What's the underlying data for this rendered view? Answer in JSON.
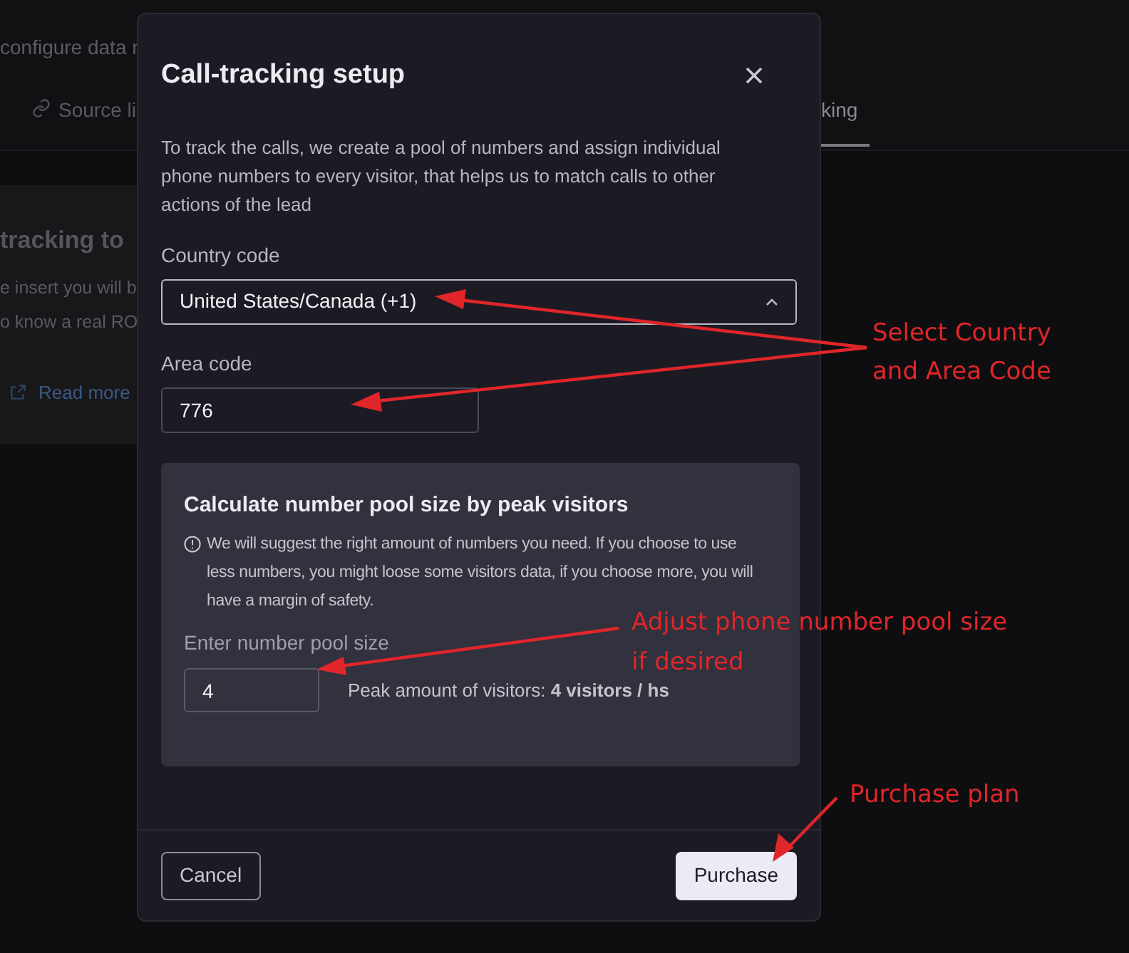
{
  "background": {
    "intro_text": "configure data r",
    "tabs": [
      {
        "label": "Source li",
        "selected": false
      },
      {
        "label": "king",
        "selected": true
      }
    ],
    "card": {
      "title": "tracking to",
      "lines": [
        "e insert you will b",
        "o know a real RO"
      ],
      "link": "Read more"
    }
  },
  "dialog": {
    "title": "Call-tracking setup",
    "description": "To track the calls, we create a pool of numbers and assign individual phone numbers to every visitor, that helps us to match calls to other actions of the lead",
    "country_code": {
      "label": "Country code",
      "value": "United States/Canada (+1)",
      "expanded": true
    },
    "area_code": {
      "label": "Area code",
      "value": "776"
    },
    "pool_panel": {
      "title": "Calculate number pool size by peak visitors",
      "info": "We will suggest the right amount of numbers you need. If you choose to use less numbers, you might loose some visitors data, if you choose more, you will have a margin of safety.",
      "input_label": "Enter number pool size",
      "value": "4",
      "peak": "Peak amount of visitors: **4 visitors / hs**"
    },
    "buttons": [
      {
        "label": "Cancel",
        "kind": "secondary"
      },
      {
        "label": "Purchase",
        "kind": "primary"
      }
    ]
  },
  "annotations": [
    {
      "text": "Select Country\nand Area Code"
    },
    {
      "text": "Adjust phone number pool size\nif desired"
    },
    {
      "text": "Purchase plan"
    }
  ]
}
